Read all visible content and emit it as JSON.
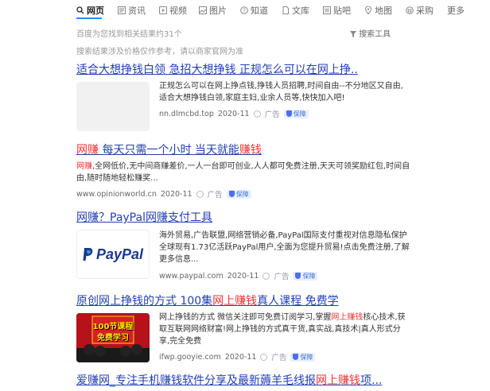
{
  "nav": {
    "tabs": [
      {
        "label": "网页",
        "icon": "search-icon",
        "active": true
      },
      {
        "label": "资讯",
        "icon": "news-icon"
      },
      {
        "label": "视频",
        "icon": "video-icon"
      },
      {
        "label": "图片",
        "icon": "image-icon"
      },
      {
        "label": "知道",
        "icon": "question-icon"
      },
      {
        "label": "文库",
        "icon": "document-icon"
      },
      {
        "label": "贴吧",
        "icon": "forum-icon"
      },
      {
        "label": "地图",
        "icon": "map-pin-icon"
      },
      {
        "label": "采购",
        "icon": "shopping-icon"
      },
      {
        "label": "更多",
        "icon": ""
      }
    ]
  },
  "meta": {
    "result_count": "百度为您找到相关结果约31个",
    "search_tools": "搜索工具",
    "disclaimer": "搜索结果涉及价格仅作参考，请以商家官网为准"
  },
  "results": [
    {
      "title": "适合大想挣钱白领 急招大想挣钱 正规怎么可以在网上挣..",
      "body": "正规怎么可以在网上挣点钱,挣钱人员招聘,时间自由--不分地区又自由,适合大想挣钱白领,家庭主妇,业余人员等,快快加入吧!",
      "url": "nn.dlmcbd.top",
      "date": "2020-11",
      "ad": "广告",
      "badge": "保障"
    },
    {
      "title_hl1": "网赚",
      "title_mid": " 每天只需一个小时 当天就能",
      "title_hl2": "赚钱",
      "body_hl": "网赚",
      "body_rest": ",全网低价,无中间商赚差价,一人一台即可创业,人人都可免费注册,天天可领奖励红包,时间自由,随时随地轻松赚奖...",
      "url": "www.opinionworld.cn",
      "date": "2020-11",
      "ad": "广告",
      "badge": "保障"
    },
    {
      "title": "网赚？PayPal网赚支付工具",
      "logo_text": "PayPal",
      "body": "海外贸易,广告联盟,网络营销必备,PayPal国际支付重视对信息隐私保护 全球现有1.73亿活跃PayPal用户,全面为您提升贸易!点击免费注册,了解更多信息...",
      "url": "www.paypal.com",
      "date": "2020-11",
      "ad": "广告",
      "badge": "保障"
    },
    {
      "title_a": "原创网上挣钱的方式 100集",
      "title_hl": "网上赚钱",
      "title_b": "真人课程 免费学",
      "thumb_line1": "100节课程",
      "thumb_line2": "免费学习",
      "body_a": "网上挣钱的方式 微信关注即可免费订阅学习,掌握",
      "body_hl": "网上赚钱",
      "body_b": "核心技术,获取互联网网络财富!网上挣钱的方式真干货,真实战,真技术|真人形式分享,完全免费",
      "url": "ifwp.gooyie.com",
      "date": "2020-11",
      "ad": "广告",
      "badge": "保障"
    },
    {
      "title_a": "爱赚网_专注手机赚钱软件分享及最新薅羊毛线报",
      "title_hl": "网上赚钱",
      "title_b": "项..."
    }
  ],
  "colors": {
    "link": "#2440b3",
    "highlight": "#f73131",
    "accent": "#3385ff"
  }
}
